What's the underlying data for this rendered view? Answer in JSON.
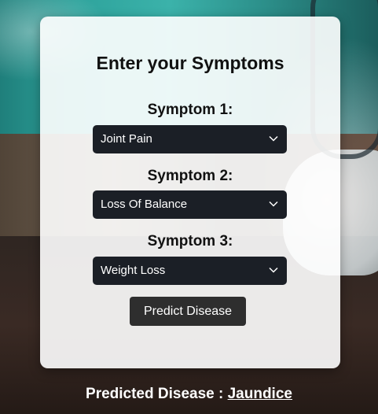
{
  "form": {
    "title": "Enter your Symptoms",
    "symptoms": [
      {
        "label": "Symptom 1:",
        "value": "Joint Pain"
      },
      {
        "label": "Symptom 2:",
        "value": "Loss Of Balance"
      },
      {
        "label": "Symptom 3:",
        "value": "Weight Loss"
      }
    ],
    "predict_label": "Predict Disease"
  },
  "result": {
    "prefix": "Predicted Disease :",
    "disease": "Jaundice"
  },
  "icons": {
    "dropdown": "chevron-down-icon"
  },
  "colors": {
    "card_bg": "#ffffff",
    "select_bg": "#1b1f26",
    "button_bg": "#2e2e2e",
    "text_dark": "#111111",
    "text_light": "#ffffff"
  }
}
